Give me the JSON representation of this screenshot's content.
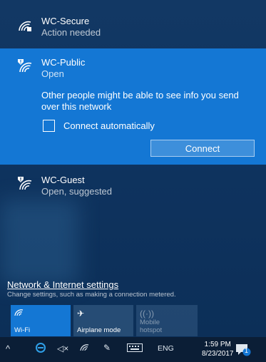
{
  "networks": [
    {
      "name": "WC-Secure",
      "status": "Action needed"
    },
    {
      "name": "WC-Public",
      "status": "Open",
      "warning": "Other people might be able to see info you send over this network",
      "auto_connect_label": "Connect automatically",
      "auto_connect_checked": false,
      "connect_label": "Connect"
    },
    {
      "name": "WC-Guest",
      "status": "Open, suggested"
    }
  ],
  "settings": {
    "link": "Network & Internet settings",
    "description": "Change settings, such as making a connection metered."
  },
  "quick_actions": [
    {
      "label": "Wi-Fi",
      "icon": "wifi-icon",
      "active": true
    },
    {
      "label": "Airplane mode",
      "icon": "airplane-icon",
      "active": false
    },
    {
      "label": "Mobile hotspot",
      "icon": "hotspot-icon",
      "active": false,
      "disabled": true
    }
  ],
  "taskbar": {
    "language": "ENG",
    "time": "1:59 PM",
    "date": "8/23/2017",
    "notification_count": "1"
  },
  "colors": {
    "accent": "#1477d4",
    "flyout_bg": "#0f3460",
    "taskbar_bg": "#0b1e36"
  }
}
